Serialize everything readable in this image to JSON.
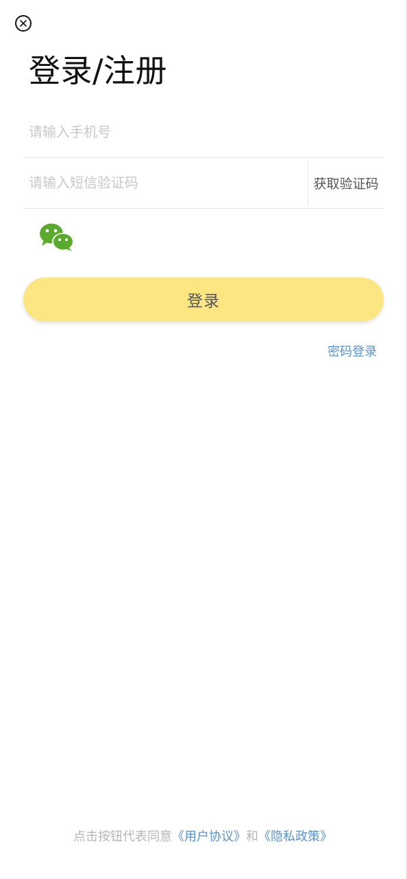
{
  "header": {
    "close_icon": "close-circle-icon",
    "title": "登录/注册"
  },
  "form": {
    "phone_placeholder": "请输入手机号",
    "code_placeholder": "请输入短信验证码",
    "get_code_label": "获取验证码"
  },
  "social": {
    "wechat_icon": "wechat-icon",
    "wechat_color": "#5aaa2e"
  },
  "actions": {
    "login_label": "登录",
    "login_button_color": "#fce682",
    "password_login_label": "密码登录",
    "link_color": "#5b92c8"
  },
  "agreement": {
    "prefix": "点击按钮代表同意",
    "user_agreement": "《用户协议》",
    "conjunction": "和",
    "privacy_policy": "《隐私政策》"
  }
}
